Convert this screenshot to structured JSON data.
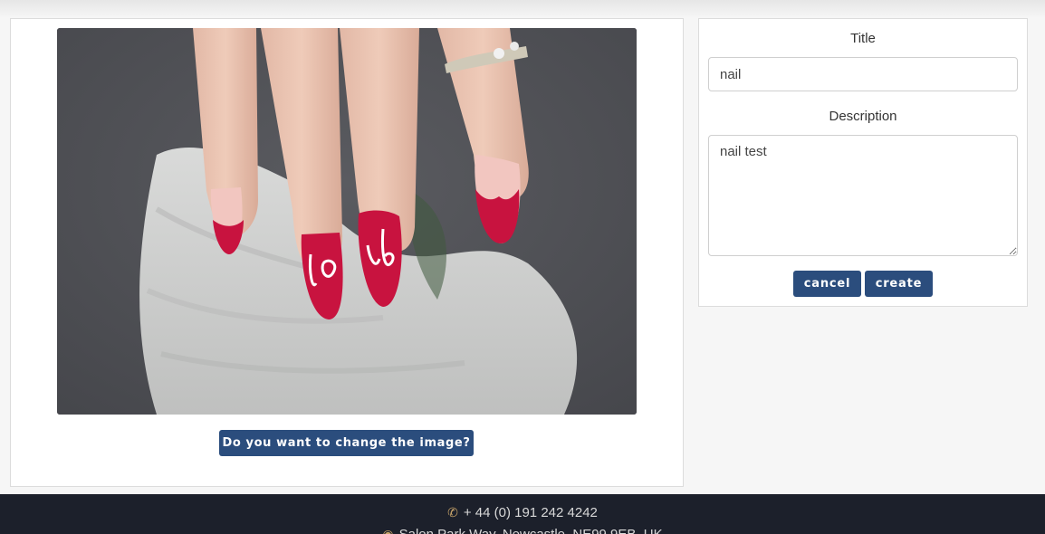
{
  "image_panel": {
    "change_image_button": "Do you want to change the image?"
  },
  "form": {
    "title_label": "Title",
    "title_value": "nail",
    "description_label": "Description",
    "description_value": "nail test",
    "cancel_label": "cancel",
    "create_label": "create"
  },
  "footer": {
    "phone": "+ 44 (0) 191 242 4242",
    "address": "Salon Park Way, Newcastle, NE99 9EB, UK",
    "phone_icon": "phone-icon",
    "address_icon": "map-pin-icon"
  },
  "colors": {
    "button": "#2b4d7d",
    "footer_bg": "#1c202b",
    "footer_icon": "#c9a56a",
    "nail_red": "#c8133f"
  }
}
